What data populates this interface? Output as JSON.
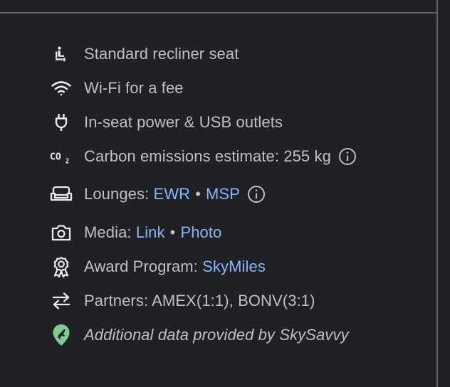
{
  "amenities": {
    "seat": {
      "label": "Standard recliner seat",
      "icon": "seat-icon"
    },
    "wifi": {
      "label": "Wi-Fi for a fee",
      "icon": "wifi-icon"
    },
    "power": {
      "label": "In-seat power & USB outlets",
      "icon": "power-plug-icon"
    },
    "carbon": {
      "label": "Carbon emissions estimate: 255 kg",
      "icon": "co2-icon"
    },
    "lounges": {
      "prefix": "Lounges: ",
      "links": [
        "EWR",
        "MSP"
      ],
      "separator": "•",
      "icon": "lounge-sofa-icon"
    },
    "media": {
      "prefix": "Media: ",
      "links": [
        "Link",
        "Photo"
      ],
      "separator": "•",
      "icon": "camera-icon"
    },
    "award": {
      "prefix": "Award Program: ",
      "link": "SkyMiles",
      "icon": "award-ribbon-icon"
    },
    "partners": {
      "label": "Partners: AMEX(1:1), BONV(3:1)",
      "icon": "swap-arrows-icon"
    },
    "source": {
      "label": "Additional data provided by SkySavvy",
      "icon": "location-plane-icon"
    }
  },
  "colors": {
    "background": "#202124",
    "text": "#bdc1c6",
    "link": "#8ab4f8",
    "icon": "#e8eaed",
    "source_pin": "#81c995",
    "divider": "#5f6368"
  }
}
